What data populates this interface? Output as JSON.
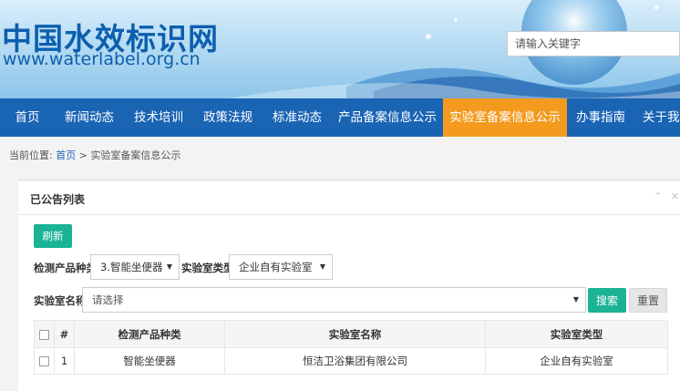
{
  "header": {
    "logo_cn": "中国水效标识网",
    "logo_en": "www.waterlabel.org.cn",
    "search_placeholder": "请输入关键字"
  },
  "nav": {
    "items": [
      {
        "label": "首页"
      },
      {
        "label": "新闻动态"
      },
      {
        "label": "技术培训"
      },
      {
        "label": "政策法规"
      },
      {
        "label": "标准动态"
      },
      {
        "label": "产品备案信息公示"
      },
      {
        "label": "实验室备案信息公示",
        "active": true
      },
      {
        "label": "办事指南"
      },
      {
        "label": "关于我"
      }
    ]
  },
  "breadcrumb": {
    "prefix": "当前位置:",
    "home": "首页",
    "separator": ">",
    "current": "实验室备案信息公示"
  },
  "panel": {
    "title": "已公告列表",
    "collapse_icon": "chevron-up-icon",
    "close_icon": "close-icon"
  },
  "filters": {
    "refresh_label": "刷新",
    "category_label": "检测产品种类",
    "category_value": "3.智能坐便器",
    "lab_type_label": "实验室类型",
    "lab_type_value": "企业自有实验室",
    "lab_name_label": "实验室名称",
    "lab_name_placeholder": "请选择",
    "search_label": "搜索",
    "reset_label": "重置"
  },
  "table": {
    "columns": [
      "#",
      "检测产品种类",
      "实验室名称",
      "实验室类型"
    ],
    "rows": [
      {
        "index": "1",
        "category": "智能坐便器",
        "lab_name": "恒洁卫浴集团有限公司",
        "lab_type": "企业自有实验室"
      }
    ]
  },
  "colors": {
    "nav_bg": "#1a64b4",
    "nav_active": "#f39a1f",
    "primary_button": "#1ab394"
  }
}
